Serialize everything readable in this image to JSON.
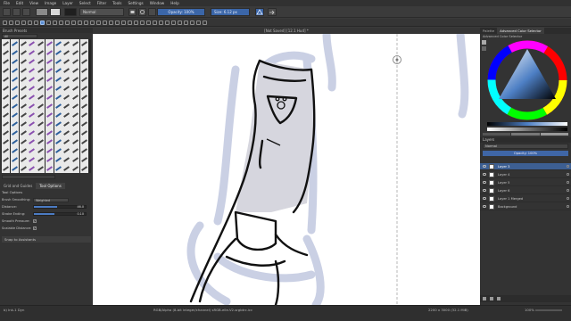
{
  "menu": [
    "File",
    "Edit",
    "View",
    "Image",
    "Layer",
    "Select",
    "Filter",
    "Tools",
    "Settings",
    "Window",
    "Help"
  ],
  "toolbar": {
    "blend_mode": "Normal",
    "opacity_label": "Opacity: 100%",
    "size_label": "Size: 6.12 px"
  },
  "document": {
    "title": "[Not Saved] [12.1 Hud] *"
  },
  "brush_presets": {
    "title": "Brush Presets",
    "filter_label": "All"
  },
  "left_tabs": [
    "Grid and Guides",
    "Tool Options"
  ],
  "tool_options": {
    "title": "Tool Options",
    "rows": [
      {
        "label": "Brush Smoothing:",
        "value": "Weighted"
      },
      {
        "label": "Distance:",
        "value": "46.0"
      },
      {
        "label": "Stroke Ending:",
        "value": "0.10"
      },
      {
        "label": "Smooth Pressure:",
        "value": "✓"
      },
      {
        "label": "Scalable Distance:",
        "value": "✓"
      }
    ],
    "snap_label": "Snap to Assistants"
  },
  "right_tabs": [
    "Palette",
    "Advanced Color Selector"
  ],
  "color_selector": {
    "title": "Advanced Color Selector",
    "accent": "#4d7fc4"
  },
  "layers": {
    "title": "Layers",
    "blend_mode": "Normal",
    "opacity_label": "Opacity: 100%",
    "items": [
      {
        "name": "Layer 3",
        "selected": true
      },
      {
        "name": "Layer 4",
        "selected": false
      },
      {
        "name": "Layer 5",
        "selected": false
      },
      {
        "name": "Layer 6",
        "selected": false
      },
      {
        "name": "Layer 1 Merged",
        "selected": false
      },
      {
        "name": "Background",
        "selected": false
      }
    ]
  },
  "status": {
    "tool": "b) Ink-1 Dyn",
    "color_space": "RGB/Alpha (8-bit integer/channel)  sRGB-elle-V2-srgbtrc.icc",
    "image_size": "2200 x 3000 (32.1 MiB)",
    "zoom": "100%"
  }
}
